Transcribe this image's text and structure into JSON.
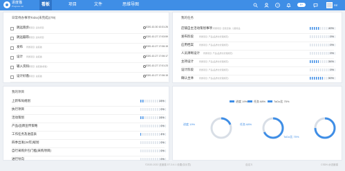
{
  "app": {
    "logo_text": "进度猫",
    "logo_sub": "Progress cat",
    "badge": "9+",
    "avatar_name": "RE",
    "brand_color": "#3f8ee6"
  },
  "nav": [
    {
      "label": "看板",
      "active": true
    },
    {
      "label": "项目",
      "active": false
    },
    {
      "label": "文件",
      "active": false
    },
    {
      "label": "思维导图",
      "active": false
    }
  ],
  "todo_panel": {
    "title": "日常待办事项ToDo(未完成)(7/9)",
    "items": [
      {
        "title": "跳远跑步",
        "project": "所属项目: 运动项目",
        "date": "2020-10-30 10:31:26"
      },
      {
        "title": "跳远蹦带",
        "project": "所属项目: 运动项目",
        "date": "2020-10-27 17:03:59"
      },
      {
        "title": "发布",
        "project": "所属项目: 进度猫",
        "date": "2020-10-27 17:06:15"
      },
      {
        "title": "设计",
        "project": "所属项目: 进度猫",
        "date": "2020-10-27 17:06:17"
      },
      {
        "title": "输入资料",
        "project": "所属项目: 进度猫(模板)",
        "date": "2020-10-27 17:01:23"
      },
      {
        "title": "设计好看",
        "project": "所属项目: 进度猫",
        "date": "2020-10-27 17:06:15"
      }
    ]
  },
  "my_tasks_panel": {
    "title": "我的任务",
    "items": [
      {
        "name": "店铺自主活动策划事项",
        "project": "所属项目: 自营店铺: 儿童用品",
        "percent": "40%",
        "fill": 40
      },
      {
        "name": "发布阶段",
        "project": "所属项目: 产品(品质化管理规范)",
        "percent": "0%",
        "fill": 0
      },
      {
        "name": "应用档案",
        "project": "所属项目: 产品(品质化管理规范)",
        "percent": "0%",
        "fill": 0
      },
      {
        "name": "人员清晰设计",
        "project": "所属项目: 产品(品质化管理规范)",
        "percent": "0%",
        "fill": 0
      },
      {
        "name": "主持设计",
        "project": "所属项目: 产品(品质化管理规范)",
        "percent": "34%",
        "fill": 34
      },
      {
        "name": "设计阶段",
        "project": "所属项目: 产品(品质化管理规范)",
        "percent": "0%",
        "fill": 0
      },
      {
        "name": "确认主体",
        "project": "所属项目: 产品(品质化管理规范)",
        "percent": "50%",
        "fill": 50
      }
    ]
  },
  "my_projects_panel": {
    "title": "我的项目",
    "items": [
      {
        "name": "上新布局规划",
        "percent": "15%",
        "fill": 15
      },
      {
        "name": "执行项目",
        "percent": "0%",
        "fill": 0
      },
      {
        "name": "活动策划",
        "percent": "15%",
        "fill": 15
      },
      {
        "name": "产品/品牌宣传策略",
        "percent": "0%",
        "fill": 0
      },
      {
        "name": "工作任务及进度表",
        "percent": "4%",
        "fill": 4
      },
      {
        "name": "四季出发(24年)规划",
        "percent": "0%",
        "fill": 0
      },
      {
        "name": "自行采购外包门槛(采购项目)",
        "percent": "0%",
        "fill": 0
      },
      {
        "name": "进行导向",
        "percent": "0%",
        "fill": 0
      }
    ]
  },
  "chart_data": {
    "type": "pie",
    "legend": [
      "进度 19%",
      "任务 68%",
      "ToDo比 75%"
    ],
    "series": [
      {
        "name": "进度",
        "value": 19,
        "label": "进度 19%"
      },
      {
        "name": "任务",
        "value": 68,
        "label": "任务 68%"
      },
      {
        "name": "ToDo比",
        "value": 75,
        "label": "ToDo比 75%"
      }
    ]
  },
  "footer": {
    "text": "©2020-2022 进度猫 DT-3.6.1 设置(仅示意)",
    "small": "自定义",
    "right": "CSDN @进度猫"
  }
}
